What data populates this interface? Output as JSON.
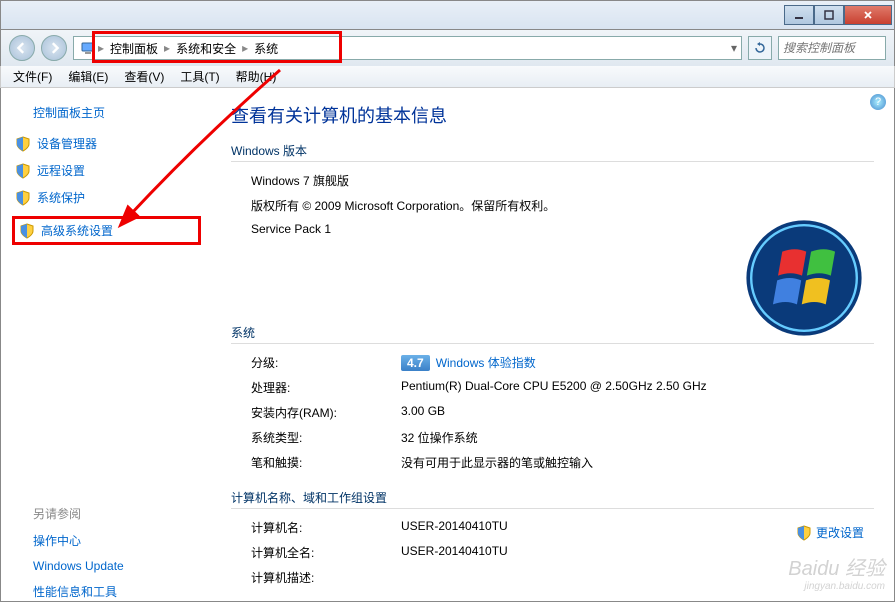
{
  "breadcrumbs": [
    "控制面板",
    "系统和安全",
    "系统"
  ],
  "search_placeholder": "搜索控制面板",
  "menu": {
    "file": "文件(F)",
    "edit": "编辑(E)",
    "view": "查看(V)",
    "tools": "工具(T)",
    "help": "帮助(H)"
  },
  "sidebar": {
    "home": "控制面板主页",
    "items": [
      {
        "label": "设备管理器"
      },
      {
        "label": "远程设置"
      },
      {
        "label": "系统保护"
      },
      {
        "label": "高级系统设置"
      }
    ],
    "see_also": "另请参阅",
    "links": [
      {
        "label": "操作中心"
      },
      {
        "label": "Windows Update"
      },
      {
        "label": "性能信息和工具"
      }
    ]
  },
  "main": {
    "title": "查看有关计算机的基本信息",
    "edition_section": "Windows 版本",
    "edition": "Windows 7 旗舰版",
    "copyright": "版权所有 © 2009 Microsoft Corporation。保留所有权利。",
    "service_pack": "Service Pack 1",
    "system_section": "系统",
    "rating_label": "分级:",
    "rating_score": "4.7",
    "rating_link": "Windows 体验指数",
    "cpu_label": "处理器:",
    "cpu_value": "Pentium(R) Dual-Core  CPU      E5200  @ 2.50GHz   2.50 GHz",
    "ram_label": "安装内存(RAM):",
    "ram_value": "3.00 GB",
    "systype_label": "系统类型:",
    "systype_value": "32 位操作系统",
    "pen_label": "笔和触摸:",
    "pen_value": "没有可用于此显示器的笔或触控输入",
    "name_section": "计算机名称、域和工作组设置",
    "cname_label": "计算机名:",
    "cname_value": "USER-20140410TU",
    "cfull_label": "计算机全名:",
    "cfull_value": "USER-20140410TU",
    "cdesc_label": "计算机描述:",
    "change_settings": "更改设置"
  },
  "watermark": {
    "brand": "Baidu 经验",
    "url": "jingyan.baidu.com"
  }
}
